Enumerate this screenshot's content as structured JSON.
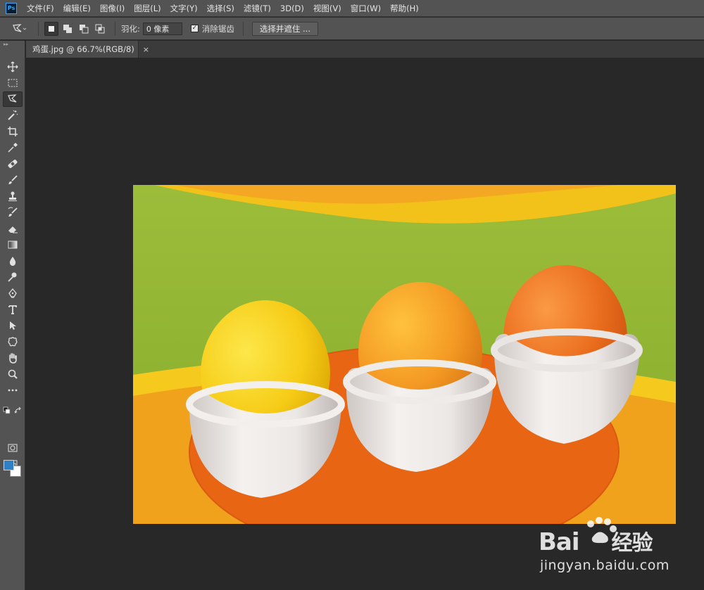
{
  "app": {
    "logo_text": "Ps"
  },
  "menu": [
    {
      "label": "文件(F)"
    },
    {
      "label": "编辑(E)"
    },
    {
      "label": "图像(I)"
    },
    {
      "label": "图层(L)"
    },
    {
      "label": "文字(Y)"
    },
    {
      "label": "选择(S)"
    },
    {
      "label": "滤镜(T)"
    },
    {
      "label": "3D(D)"
    },
    {
      "label": "视图(V)"
    },
    {
      "label": "窗口(W)"
    },
    {
      "label": "帮助(H)"
    }
  ],
  "options": {
    "feather_label": "羽化:",
    "feather_value": "0 像素",
    "antialias_label": "消除锯齿",
    "antialias_checked": true,
    "select_mask_label": "选择并遮住 ..."
  },
  "document": {
    "tab_title": "鸡蛋.jpg @ 66.7%(RGB/8)",
    "close_glyph": "×"
  },
  "colors": {
    "foreground": "#2f80c4",
    "background": "#ffffff"
  },
  "tools": [
    {
      "name": "move-tool"
    },
    {
      "name": "marquee-tool"
    },
    {
      "name": "lasso-tool",
      "active": true
    },
    {
      "name": "magic-wand-tool"
    },
    {
      "name": "crop-tool"
    },
    {
      "name": "eyedropper-tool"
    },
    {
      "name": "healing-brush-tool"
    },
    {
      "name": "brush-tool"
    },
    {
      "name": "clone-stamp-tool"
    },
    {
      "name": "history-brush-tool"
    },
    {
      "name": "eraser-tool"
    },
    {
      "name": "gradient-tool"
    },
    {
      "name": "blur-tool"
    },
    {
      "name": "dodge-tool"
    },
    {
      "name": "pen-tool"
    },
    {
      "name": "type-tool"
    },
    {
      "name": "path-selection-tool"
    },
    {
      "name": "custom-shape-tool"
    },
    {
      "name": "hand-tool"
    },
    {
      "name": "zoom-tool"
    },
    {
      "name": "more-tools"
    }
  ],
  "watermark": {
    "brand": "Bai",
    "brand_cn": "经验",
    "url": "jingyan.baidu.com"
  }
}
